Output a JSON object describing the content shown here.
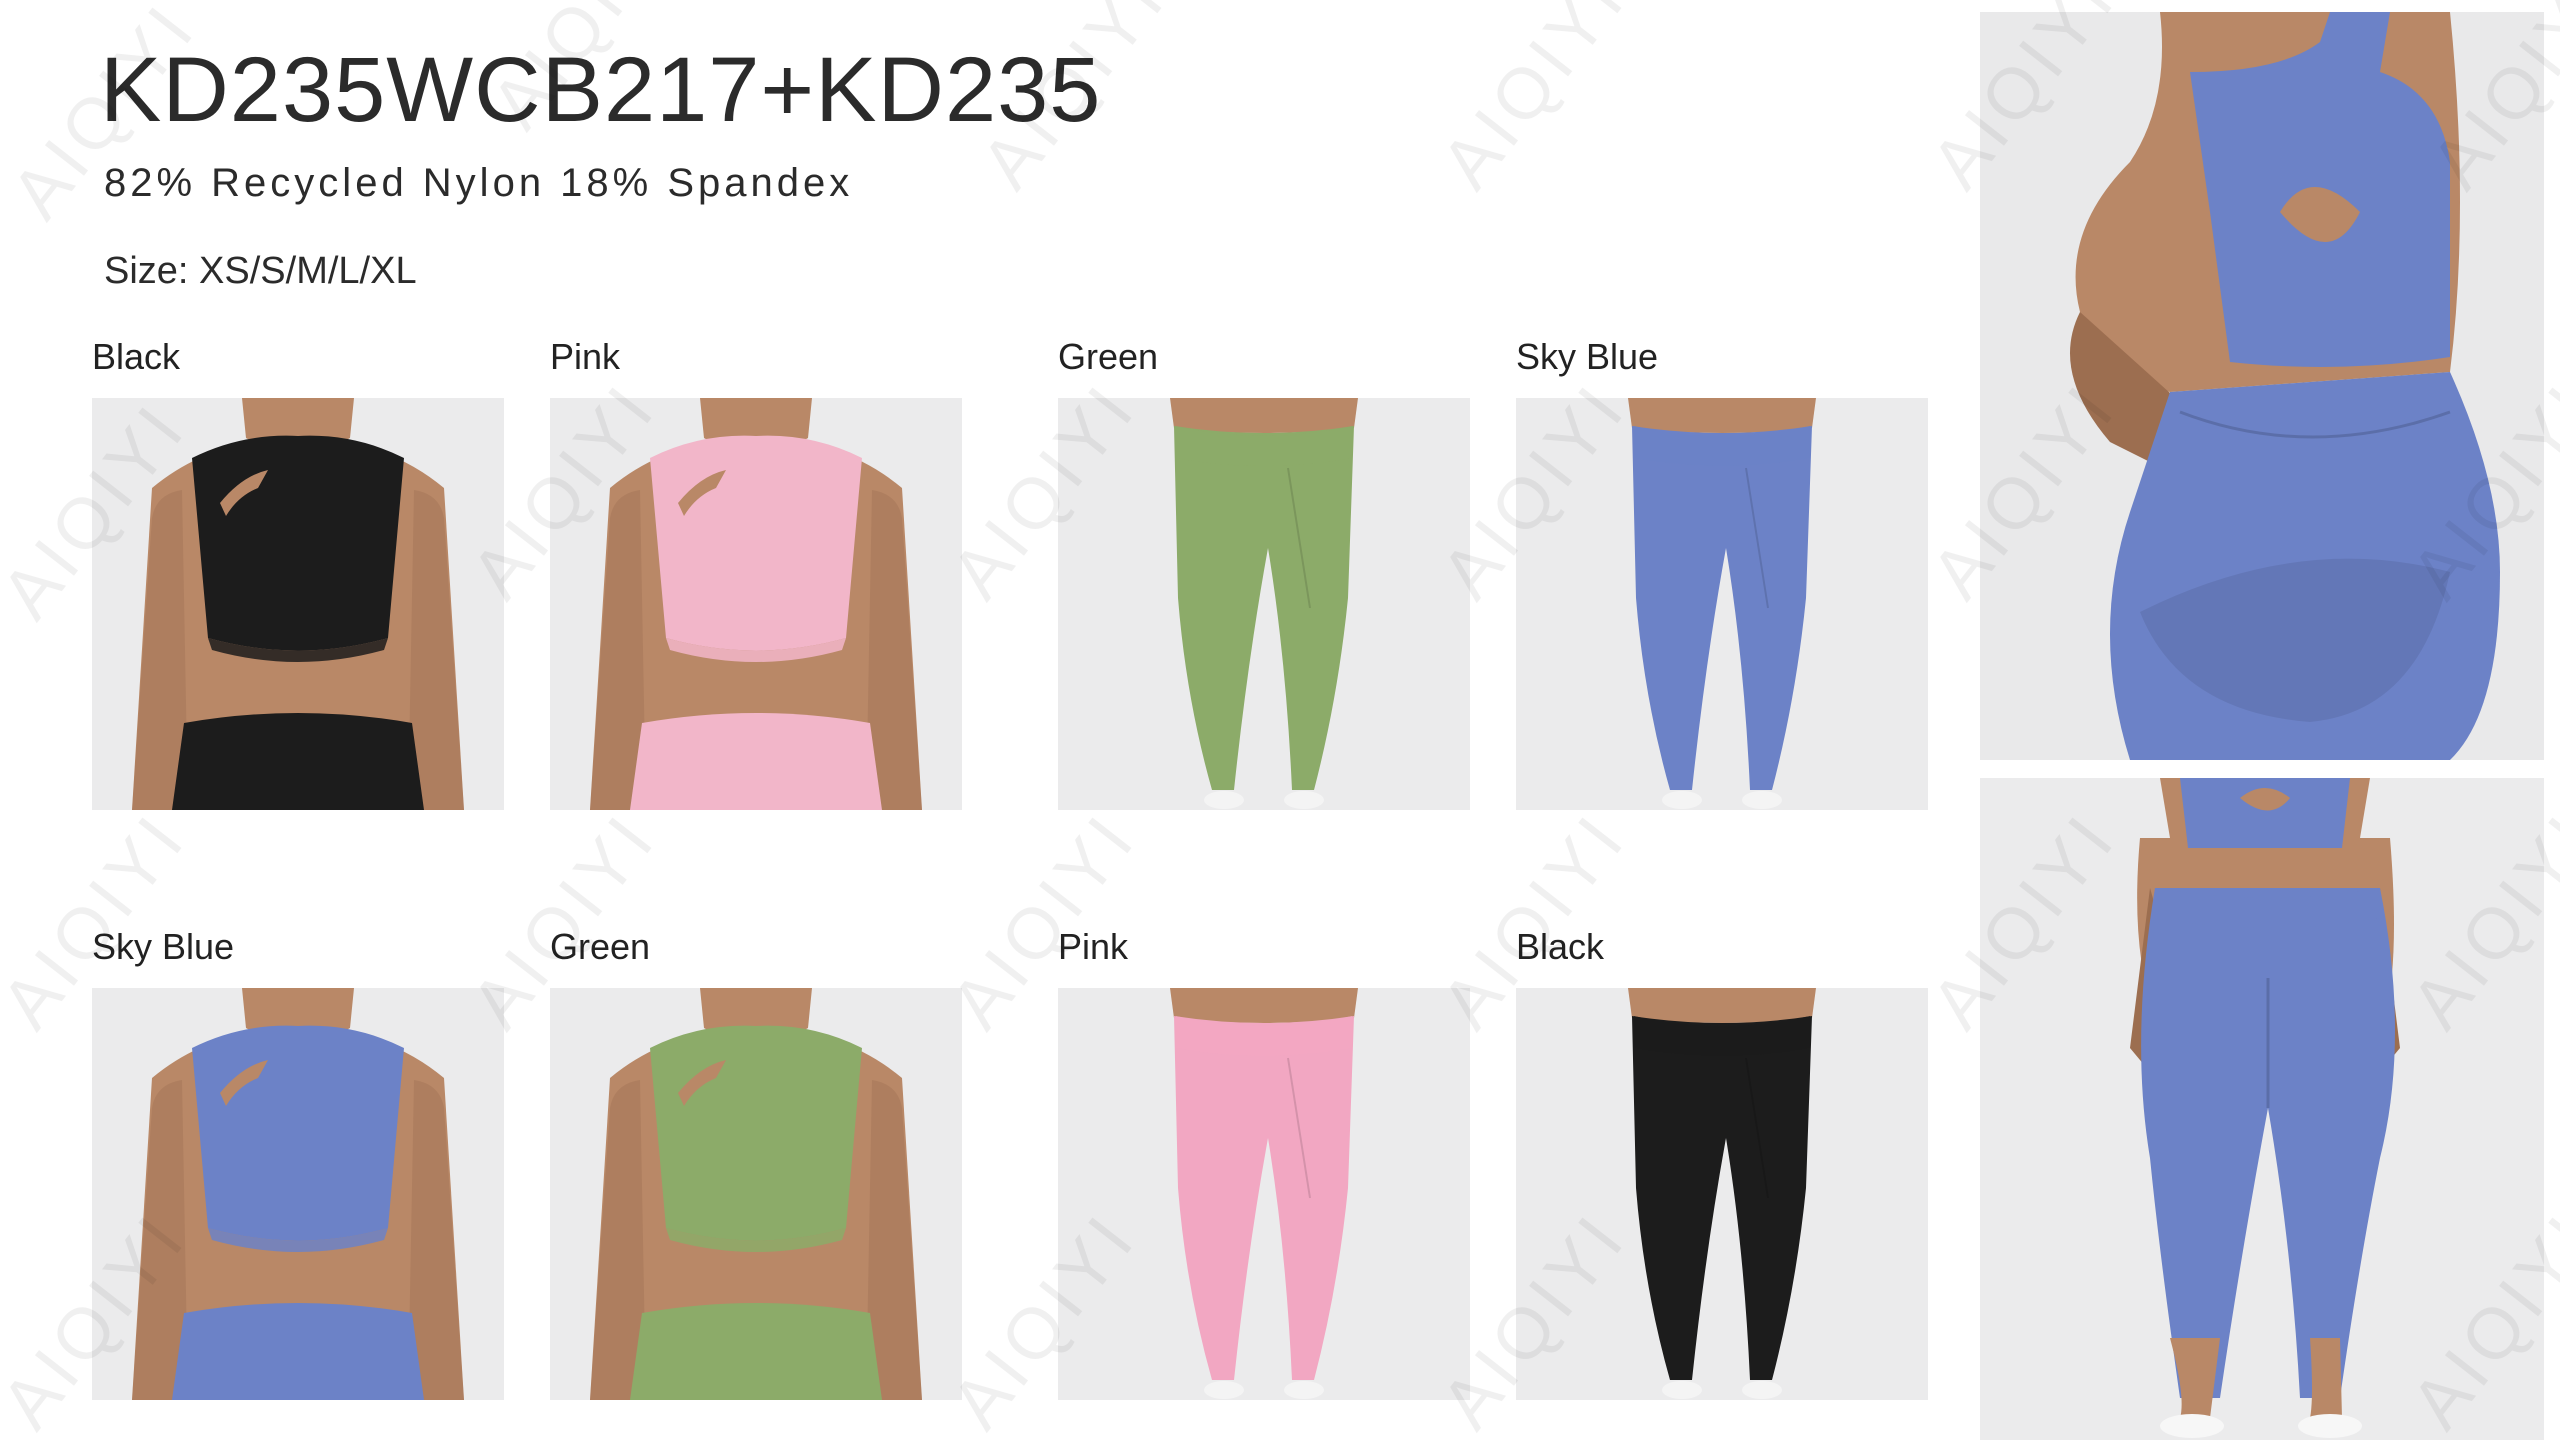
{
  "product": {
    "title": "KD235WCB217+KD235",
    "material": "82% Recycled Nylon 18% Spandex",
    "sizes": "Size: XS/S/M/L/XL"
  },
  "watermark": "AIQIYI",
  "swatches": [
    {
      "label": "Black",
      "type": "top",
      "color": "#1c1c1c"
    },
    {
      "label": "Pink",
      "type": "top",
      "color": "#f2b6c9"
    },
    {
      "label": "Green",
      "type": "leggings",
      "color": "#8cab69"
    },
    {
      "label": "Sky Blue",
      "type": "leggings",
      "color": "#6c82c7"
    },
    {
      "label": "Sky Blue",
      "type": "top",
      "color": "#6c82c7"
    },
    {
      "label": "Green",
      "type": "top",
      "color": "#8cab69"
    },
    {
      "label": "Pink",
      "type": "leggings",
      "color": "#f2a7c2"
    },
    {
      "label": "Black",
      "type": "leggings",
      "color": "#1c1c1c"
    }
  ],
  "hero_images": [
    {
      "view": "back-close-up",
      "color": "#6c82c7"
    },
    {
      "view": "back-full-body",
      "color": "#6c82c7"
    }
  ],
  "colors": {
    "skin": "#b98867",
    "skin_shadow": "#9c6e50",
    "background": "#ebebec"
  }
}
